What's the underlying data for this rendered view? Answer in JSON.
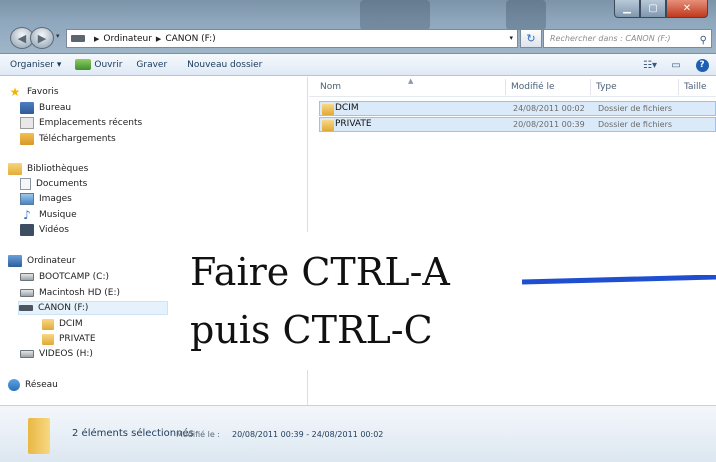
{
  "breadcrumb": [
    "Ordinateur",
    "CANON (F:)"
  ],
  "search": {
    "placeholder": "Rechercher dans : CANON (F:)"
  },
  "toolbar": {
    "organize": "Organiser ▾",
    "open": "Ouvrir",
    "burn": "Graver",
    "new_folder": "Nouveau dossier"
  },
  "sidebar": {
    "favorites": "Favoris",
    "favorites_items": [
      "Bureau",
      "Emplacements récents",
      "Téléchargements"
    ],
    "libraries": "Bibliothèques",
    "libraries_items": [
      "Documents",
      "Images",
      "Musique",
      "Vidéos"
    ],
    "computer": "Ordinateur",
    "drives": [
      "BOOTCAMP (C:)",
      "Macintosh HD (E:)",
      "CANON (F:)"
    ],
    "canon_children": [
      "DCIM",
      "PRIVATE"
    ],
    "videos_drive": "VIDEOS (H:)",
    "network": "Réseau"
  },
  "columns": {
    "name": "Nom",
    "modified": "Modifié le",
    "type": "Type",
    "size": "Taille"
  },
  "files": [
    {
      "name": "DCIM",
      "modified": "24/08/2011 00:02",
      "type": "Dossier de fichiers"
    },
    {
      "name": "PRIVATE",
      "modified": "20/08/2011 00:39",
      "type": "Dossier de fichiers"
    }
  ],
  "details": {
    "selection": "2 éléments sélectionnés",
    "modified_label": "Modifié le :",
    "modified_value": "20/08/2011 00:39 - 24/08/2011 00:02"
  },
  "annotation": {
    "line1": "Faire CTRL-A",
    "line2": "puis CTRL-C",
    "color": "#1f4fd0"
  },
  "colors": {
    "selection_fill": "#dbeaf9",
    "selection_border": "#9fc1e8"
  }
}
